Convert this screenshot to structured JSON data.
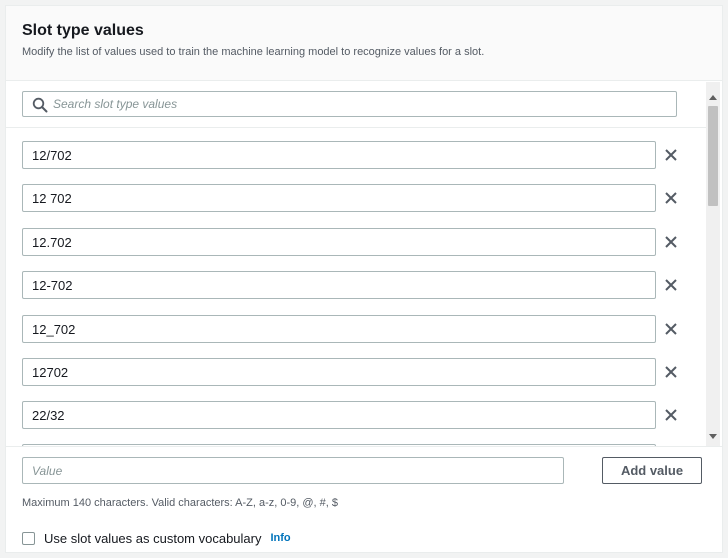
{
  "panel": {
    "title": "Slot type values",
    "subtitle": "Modify the list of values used to train the machine learning model to recognize values for a slot."
  },
  "search": {
    "placeholder": "Search slot type values",
    "icon": "search-icon"
  },
  "values": [
    {
      "value": "12/702"
    },
    {
      "value": "12 702"
    },
    {
      "value": "12.702"
    },
    {
      "value": "12-702"
    },
    {
      "value": "12_702"
    },
    {
      "value": "12702"
    },
    {
      "value": "22/32"
    },
    {
      "value": ""
    }
  ],
  "footer": {
    "value_placeholder": "Value",
    "add_button": "Add value",
    "constraint": "Maximum 140 characters. Valid characters: A-Z, a-z, 0-9, @, #, $",
    "vocab_label": "Use slot values as custom vocabulary",
    "info_link": "Info"
  },
  "colors": {
    "accent": "#0073bb",
    "border": "#aab7b8",
    "text": "#16191f",
    "muted": "#545b64"
  }
}
